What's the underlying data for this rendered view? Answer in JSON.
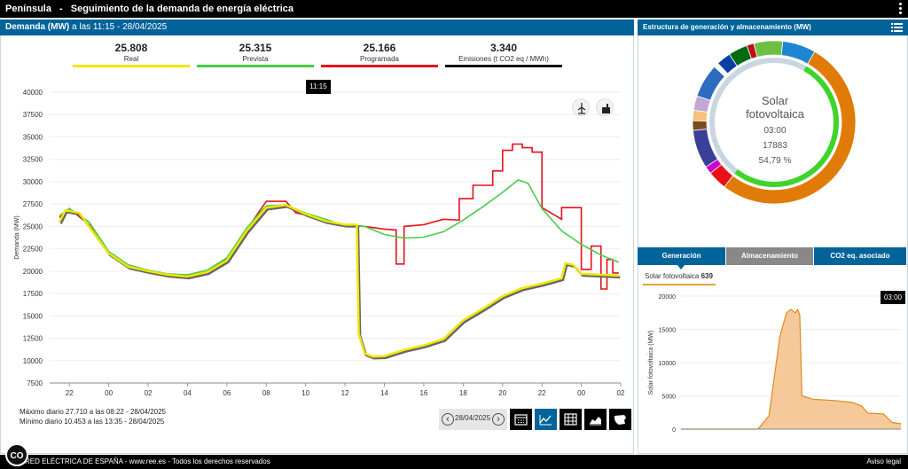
{
  "topbar": {
    "region": "Península",
    "separator": "-",
    "title": "Seguimiento de la demanda de energía eléctrica"
  },
  "demand_header": {
    "label": "Demanda (MW)",
    "time": "a las 11:15 - 28/04/2025"
  },
  "kpis": [
    {
      "value": "25.808",
      "label": "Real",
      "color": "#f1e600"
    },
    {
      "value": "25.315",
      "label": "Prevista",
      "color": "#42d046"
    },
    {
      "value": "25.166",
      "label": "Programada",
      "color": "#e8101b"
    },
    {
      "value": "3.340",
      "label": "Emisiones (t CO2 eq / MWh)",
      "color": "#111111"
    }
  ],
  "tooltip_time": "11:15",
  "chart_data": [
    {
      "type": "line",
      "ylabel": "Demanda (MW)",
      "ylim": [
        7500,
        40000
      ],
      "yticks": [
        "40000",
        "37500",
        "35000",
        "32500",
        "30000",
        "27500",
        "25000",
        "22500",
        "20000",
        "17500",
        "15000",
        "12500",
        "10000",
        "7500"
      ],
      "xticks": [
        "22",
        "00",
        "02",
        "04",
        "06",
        "08",
        "10",
        "12",
        "14",
        "16",
        "18",
        "20",
        "22",
        "00",
        "02"
      ],
      "series": [
        {
          "name": "Real",
          "color": "#f1e600",
          "points": [
            [
              -2.5,
              25500
            ],
            [
              -2.2,
              26800
            ],
            [
              -1.5,
              26500
            ],
            [
              -1,
              25000
            ],
            [
              0,
              22000
            ],
            [
              1,
              20500
            ],
            [
              2,
              20000
            ],
            [
              3,
              19600
            ],
            [
              4,
              19400
            ],
            [
              5,
              19900
            ],
            [
              6,
              21200
            ],
            [
              7,
              24500
            ],
            [
              8,
              27100
            ],
            [
              9,
              27400
            ],
            [
              10,
              26400
            ],
            [
              11,
              25600
            ],
            [
              12,
              25200
            ],
            [
              12.6,
              25200
            ],
            [
              12.7,
              13000
            ],
            [
              13,
              10800
            ],
            [
              13.4,
              10450
            ],
            [
              14,
              10500
            ],
            [
              15,
              11200
            ],
            [
              16,
              11700
            ],
            [
              17,
              12400
            ],
            [
              18,
              14500
            ],
            [
              19,
              15800
            ],
            [
              20,
              17200
            ],
            [
              21,
              18100
            ],
            [
              22,
              18600
            ],
            [
              23,
              19200
            ],
            [
              23.2,
              20900
            ],
            [
              23.6,
              20700
            ],
            [
              24,
              19700
            ],
            [
              25,
              19600
            ],
            [
              25.9,
              19500
            ]
          ]
        },
        {
          "name": "Prevista",
          "color": "#42d046",
          "points": [
            [
              -2.5,
              26200
            ],
            [
              -2,
              27000
            ],
            [
              -1,
              25500
            ],
            [
              0,
              22200
            ],
            [
              1,
              20700
            ],
            [
              2,
              20100
            ],
            [
              3,
              19700
            ],
            [
              4,
              19600
            ],
            [
              5,
              20100
            ],
            [
              6,
              21500
            ],
            [
              7,
              24800
            ],
            [
              8,
              27300
            ],
            [
              9,
              27400
            ],
            [
              10,
              26500
            ],
            [
              11,
              25800
            ],
            [
              12,
              25100
            ],
            [
              13,
              25000
            ],
            [
              14,
              24100
            ],
            [
              15,
              23700
            ],
            [
              16,
              23800
            ],
            [
              17,
              24400
            ],
            [
              18,
              25700
            ],
            [
              19,
              27200
            ],
            [
              20,
              28800
            ],
            [
              20.8,
              30200
            ],
            [
              21.3,
              29800
            ],
            [
              22,
              27000
            ],
            [
              23,
              24500
            ],
            [
              24,
              23000
            ],
            [
              25,
              21800
            ],
            [
              25.9,
              21000
            ]
          ]
        },
        {
          "name": "Programada",
          "color": "#e8101b",
          "points": [
            [
              -2.5,
              26000
            ],
            [
              -2,
              27000
            ],
            [
              -1,
              25200
            ],
            [
              0,
              22000
            ],
            [
              1,
              20500
            ],
            [
              2,
              20000
            ],
            [
              3,
              19600
            ],
            [
              4,
              19500
            ],
            [
              5,
              20000
            ],
            [
              6,
              21300
            ],
            [
              7,
              24600
            ],
            [
              8,
              27800
            ],
            [
              9,
              27800
            ],
            [
              9.5,
              26500
            ],
            [
              10,
              26300
            ],
            [
              11,
              25600
            ],
            [
              12,
              25200
            ],
            [
              13,
              25000
            ],
            [
              14,
              24700
            ],
            [
              14.6,
              24600
            ],
            [
              14.6,
              20800
            ],
            [
              15,
              20800
            ],
            [
              15,
              25000
            ],
            [
              16,
              25200
            ],
            [
              17,
              25800
            ],
            [
              17.8,
              25700
            ],
            [
              17.8,
              28100
            ],
            [
              18.5,
              28100
            ],
            [
              18.5,
              29600
            ],
            [
              19.5,
              29600
            ],
            [
              19.5,
              31200
            ],
            [
              20,
              31200
            ],
            [
              20,
              33500
            ],
            [
              20.5,
              33500
            ],
            [
              20.5,
              34200
            ],
            [
              21,
              34200
            ],
            [
              21,
              33800
            ],
            [
              21.5,
              33800
            ],
            [
              21.5,
              33300
            ],
            [
              22,
              33300
            ],
            [
              22,
              27100
            ],
            [
              23,
              25800
            ],
            [
              23,
              27100
            ],
            [
              24,
              27100
            ],
            [
              24,
              20200
            ],
            [
              24.5,
              20200
            ],
            [
              24.5,
              22800
            ],
            [
              25,
              22800
            ],
            [
              25,
              18000
            ],
            [
              25.3,
              18000
            ],
            [
              25.3,
              21300
            ],
            [
              25.6,
              21300
            ],
            [
              25.6,
              19800
            ],
            [
              25.9,
              19800
            ]
          ]
        }
      ]
    },
    {
      "type": "area",
      "ylabel": "Solar fotovoltaica (MW)",
      "ylim": [
        0,
        20000
      ],
      "yticks": [
        "20000",
        "15000",
        "10000",
        "5000",
        "0"
      ],
      "series": [
        {
          "name": "Solar fotovoltaica",
          "color": "#e8a23c",
          "points": [
            [
              0,
              0
            ],
            [
              0.35,
              0
            ],
            [
              0.4,
              2000
            ],
            [
              0.45,
              14000
            ],
            [
              0.48,
              17500
            ],
            [
              0.5,
              18000
            ],
            [
              0.52,
              17500
            ],
            [
              0.53,
              18000
            ],
            [
              0.54,
              17200
            ],
            [
              0.55,
              5000
            ],
            [
              0.6,
              4500
            ],
            [
              0.7,
              4300
            ],
            [
              0.78,
              4000
            ],
            [
              0.82,
              3500
            ],
            [
              0.85,
              2400
            ],
            [
              0.92,
              2300
            ],
            [
              0.96,
              1000
            ],
            [
              1.0,
              800
            ]
          ]
        }
      ]
    },
    {
      "type": "pie",
      "slices": [
        {
          "value": 54.79,
          "color": "#e07b07"
        },
        {
          "value": 4.0,
          "color": "#e8101b"
        },
        {
          "value": 1.6,
          "color": "#cc00cc"
        },
        {
          "value": 8.0,
          "color": "#3a3f9a"
        },
        {
          "value": 2.0,
          "color": "#7a4b1c"
        },
        {
          "value": 2.2,
          "color": "#f7c07a"
        },
        {
          "value": 3.0,
          "color": "#c3a7d6"
        },
        {
          "value": 7.0,
          "color": "#2c6cbf"
        },
        {
          "value": 1.0,
          "color": "#ffffff"
        },
        {
          "value": 3.0,
          "color": "#0b3fa3"
        },
        {
          "value": 4.0,
          "color": "#006b13"
        },
        {
          "value": 1.5,
          "color": "#bb1111"
        },
        {
          "value": 6.0,
          "color": "#6dbf44"
        },
        {
          "value": 6.9,
          "color": "#1c86d0"
        }
      ]
    }
  ],
  "stats": {
    "max": "Máximo diario 27.710 a las 08:22 - 28/04/2025",
    "min": "Mínimo diario 10.453 a las 13:35 - 28/04/2025"
  },
  "date_picker": {
    "value": "28/04/2025",
    "prev": "‹",
    "next": "›"
  },
  "right_header": "Estructura de generación y almacenamiento (MW)",
  "donut_center": {
    "name_line1": "Solar",
    "name_line2": "fotovoltaica",
    "time": "03:00",
    "value": "17883",
    "percent": "54,79 %"
  },
  "tabs": [
    {
      "label": "Generación"
    },
    {
      "label": "Almacenamiento"
    },
    {
      "label": "CO2 eq. asociado"
    }
  ],
  "solar_legend": {
    "name": "Solar fotovoltaica",
    "value": "639"
  },
  "solar_tooltip": "03:00",
  "footer": {
    "text": "RED ELÉCTRICA DE ESPAÑA - www.ree.es - Todos los derechos reservados",
    "legal": "Aviso legal"
  },
  "cookie_label": "CO",
  "icons": {
    "colors": {
      "primary": "#00639a",
      "dark": "#000000",
      "grey": "#e6e6e6"
    }
  }
}
